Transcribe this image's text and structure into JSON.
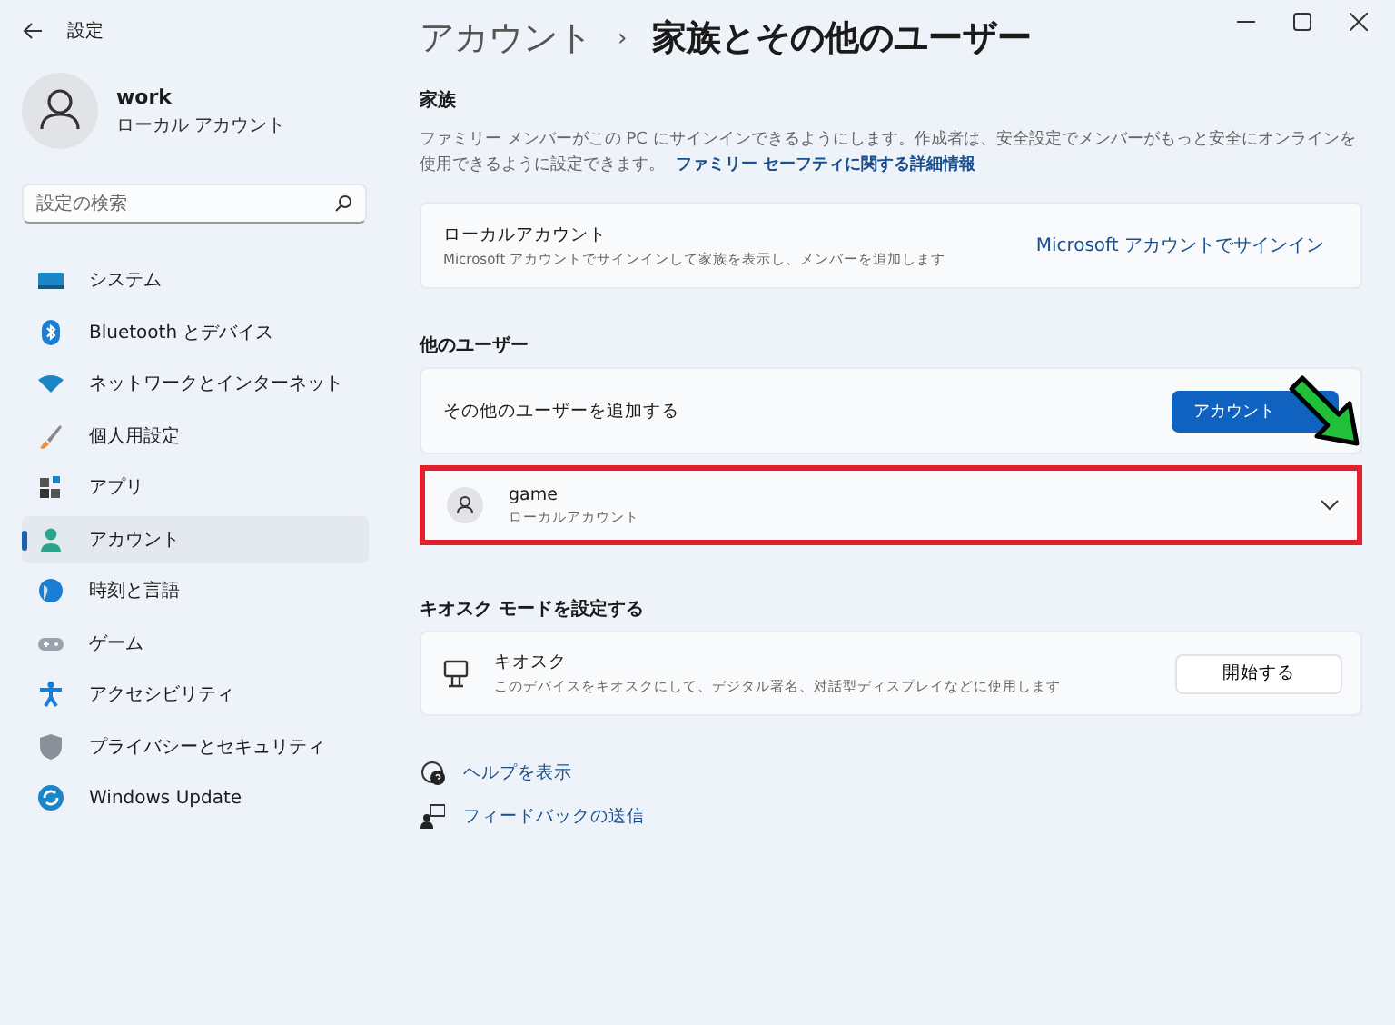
{
  "window": {
    "title": "設定"
  },
  "user": {
    "name": "work",
    "type": "ローカル アカウント"
  },
  "search": {
    "placeholder": "設定の検索"
  },
  "sidebar": {
    "items": [
      {
        "label": "システム",
        "selected": false
      },
      {
        "label": "Bluetooth とデバイス",
        "selected": false
      },
      {
        "label": "ネットワークとインターネット",
        "selected": false
      },
      {
        "label": "個人用設定",
        "selected": false
      },
      {
        "label": "アプリ",
        "selected": false
      },
      {
        "label": "アカウント",
        "selected": true
      },
      {
        "label": "時刻と言語",
        "selected": false
      },
      {
        "label": "ゲーム",
        "selected": false
      },
      {
        "label": "アクセシビリティ",
        "selected": false
      },
      {
        "label": "プライバシーとセキュリティ",
        "selected": false
      },
      {
        "label": "Windows Update",
        "selected": false
      }
    ]
  },
  "breadcrumb": {
    "parent": "アカウント",
    "separator": "›",
    "current": "家族とその他のユーザー"
  },
  "family": {
    "heading": "家族",
    "description": "ファミリー メンバーがこの PC にサインインできるようにします。作成者は、安全設定でメンバーがもっと安全にオンラインを使用できるように設定できます。",
    "link": "ファミリー セーフティに関する詳細情報",
    "card": {
      "title": "ローカルアカウント",
      "subtitle": "Microsoft アカウントでサインインして家族を表示し、メンバーを追加します",
      "action": "Microsoft アカウントでサインイン"
    }
  },
  "other_users": {
    "heading": "他のユーザー",
    "add_label": "その他のユーザーを追加する",
    "add_button": "アカウント",
    "users": [
      {
        "name": "game",
        "type": "ローカルアカウント",
        "expanded": false,
        "highlighted": true
      }
    ]
  },
  "kiosk": {
    "heading": "キオスク モードを設定する",
    "title": "キオスク",
    "subtitle": "このデバイスをキオスクにして、デジタル署名、対話型ディスプレイなどに使用します",
    "button": "開始する"
  },
  "links": [
    {
      "label": "ヘルプを表示"
    },
    {
      "label": "フィードバックの送信"
    }
  ]
}
